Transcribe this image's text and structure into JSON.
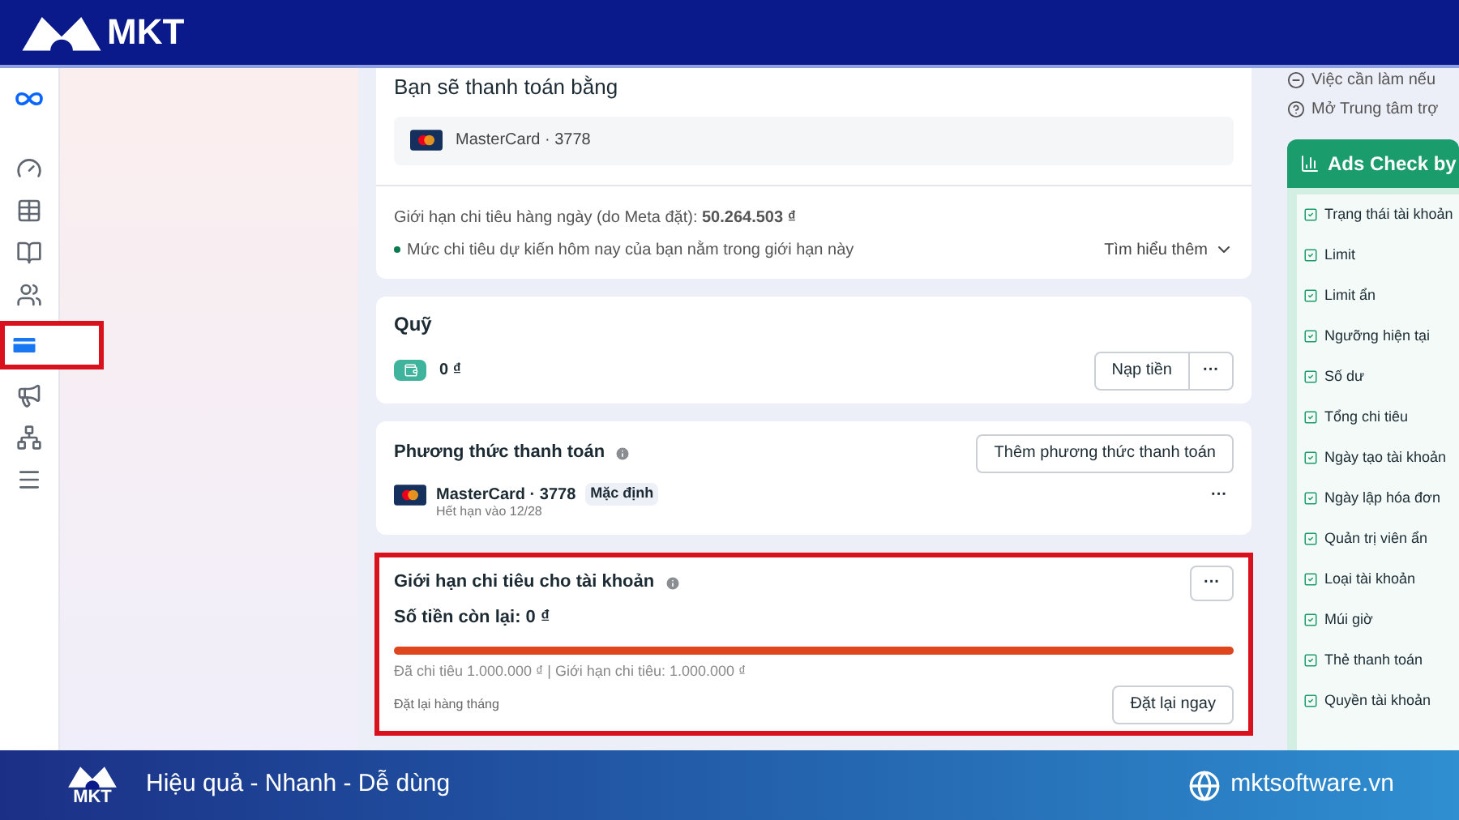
{
  "header": {
    "logo": "MKT"
  },
  "sidebar": {
    "items": [
      {
        "selected": false
      },
      {
        "selected": false
      },
      {
        "selected": false
      },
      {
        "selected": false
      },
      {
        "selected": true
      },
      {
        "selected": false
      },
      {
        "selected": false
      },
      {
        "selected": false
      }
    ]
  },
  "pay_with": {
    "title": "Bạn sẽ thanh toán bằng",
    "card": "MasterCard · 3778",
    "daily_limit": "Giới hạn chi tiêu hàng ngày (do Meta đặt): **50.264.503 ₫**",
    "note": "Mức chi tiêu dự kiến hôm nay của bạn nằm trong giới hạn này",
    "learn_more": "Tìm hiểu thêm"
  },
  "fund": {
    "title": "Quỹ",
    "balance": "0 ₫",
    "add_button": "Nạp tiền",
    "more": "···"
  },
  "payment_methods": {
    "title": "Phương thức thanh toán",
    "add_button": "Thêm phương thức thanh toán",
    "card": "MasterCard · 3778",
    "badge": "Mặc định",
    "expiry": "Hết hạn vào 12/28",
    "more": "···"
  },
  "account_limit": {
    "title": "Giới hạn chi tiêu cho tài khoản",
    "more": "···",
    "remaining": "Số tiền còn lại: 0 ₫",
    "level": 1,
    "spent": "Đã chi tiêu 1.000.000 ₫ | Giới hạn chi tiêu: 1.000.000 ₫",
    "reset_note": "Đặt lại hàng tháng",
    "reset_button": "Đặt lại ngay"
  },
  "right_panel": {
    "links": [
      "Việc cần làm nếu",
      "Mở Trung tâm trợ"
    ],
    "title": "Ads Check by",
    "items": [
      "Trạng thái tài khoản",
      "Limit",
      "Limit ẩn",
      "Ngưỡng hiện tại",
      "Số dư",
      "Tổng chi tiêu",
      "Ngày tạo tài khoản",
      "Ngày lập hóa đơn",
      "Quản trị viên ẩn",
      "Loại tài khoản",
      "Múi giờ",
      "Thẻ thanh toán",
      "Quyền tài khoản"
    ]
  },
  "footer": {
    "logo": "MKT",
    "slogan": "Hiệu quả - Nhanh - Dễ dùng",
    "website": "mktsoftware.vn"
  }
}
